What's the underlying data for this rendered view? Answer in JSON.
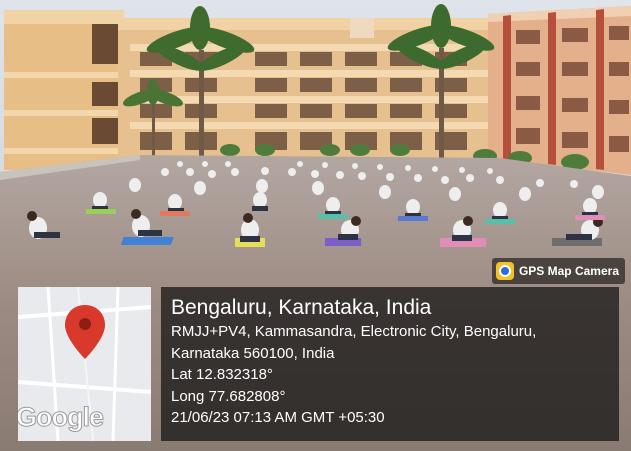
{
  "camera_badge": {
    "label": "GPS Map Camera",
    "icon": "gps-camera-app-icon"
  },
  "map": {
    "logo_text": "Google",
    "pin_icon": "map-pin-icon",
    "pin_color": "#d9392b"
  },
  "location": {
    "title": "Bengaluru, Karnataka, India",
    "address_line1": "RMJJ+PV4, Kammasandra, Electronic City, Bengaluru,",
    "address_line2": "Karnataka 560100, India",
    "latitude": "Lat 12.832318°",
    "longitude": "Long 77.682808°",
    "timestamp": "21/06/23 07:13 AM GMT +05:30"
  },
  "colors": {
    "panel_bg": "#121212",
    "badge_bg": "#141414",
    "building": "#e8c48e",
    "ground": "#9a8a7c"
  }
}
